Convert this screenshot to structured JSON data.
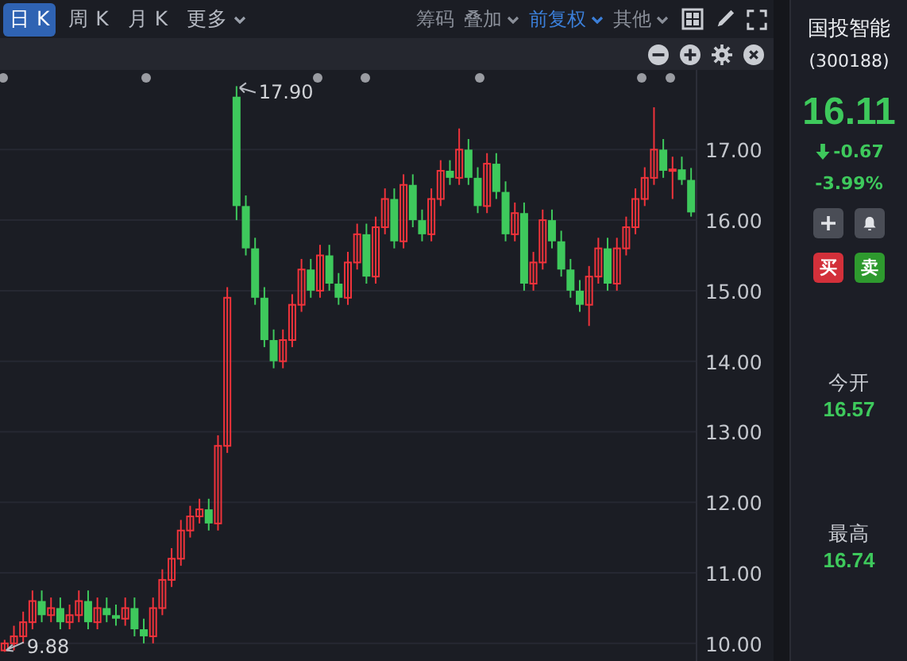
{
  "toolbar": {
    "periods": [
      {
        "label": "日 K",
        "selected": true
      },
      {
        "label": "周 K",
        "selected": false
      },
      {
        "label": "月 K",
        "selected": false
      }
    ],
    "more": {
      "label": "更多"
    },
    "options": [
      {
        "label": "筹码",
        "has_menu": false,
        "selected": false
      },
      {
        "label": "叠加",
        "has_menu": true,
        "selected": false
      },
      {
        "label": "前复权",
        "has_menu": true,
        "selected": true
      },
      {
        "label": "其他",
        "has_menu": true,
        "selected": false
      }
    ]
  },
  "chart": {
    "chart_data": {
      "type": "candlestick",
      "categories": [
        null,
        null,
        null,
        null,
        null,
        null,
        null,
        null,
        null,
        null,
        null,
        null,
        null,
        null,
        null,
        null,
        null,
        null,
        null,
        null,
        null,
        null,
        null,
        null,
        null,
        null,
        null,
        null,
        null,
        null,
        null,
        null,
        null,
        null,
        null,
        null,
        null,
        null,
        null,
        null,
        null,
        null,
        null,
        null,
        null,
        null,
        null,
        null,
        null,
        null,
        null,
        null,
        null,
        null,
        null,
        null,
        null,
        null,
        null,
        null,
        null,
        null,
        null,
        null,
        null,
        null,
        null,
        null,
        null,
        null,
        null,
        null,
        null,
        null,
        null
      ],
      "ohlc": [
        [
          9.9,
          10.05,
          9.88,
          10.0
        ],
        [
          10.0,
          10.25,
          9.9,
          10.1
        ],
        [
          10.1,
          10.45,
          10.0,
          10.3
        ],
        [
          10.3,
          10.75,
          10.2,
          10.6
        ],
        [
          10.6,
          10.75,
          10.3,
          10.4
        ],
        [
          10.4,
          10.65,
          10.3,
          10.5
        ],
        [
          10.5,
          10.65,
          10.2,
          10.3
        ],
        [
          10.3,
          10.55,
          10.2,
          10.4
        ],
        [
          10.4,
          10.75,
          10.3,
          10.6
        ],
        [
          10.6,
          10.75,
          10.2,
          10.3
        ],
        [
          10.3,
          10.65,
          10.2,
          10.5
        ],
        [
          10.5,
          10.65,
          10.3,
          10.4
        ],
        [
          10.4,
          10.55,
          10.25,
          10.35
        ],
        [
          10.35,
          10.65,
          10.25,
          10.5
        ],
        [
          10.5,
          10.65,
          10.1,
          10.2
        ],
        [
          10.2,
          10.35,
          10.0,
          10.1
        ],
        [
          10.1,
          10.65,
          10.0,
          10.5
        ],
        [
          10.5,
          11.05,
          10.4,
          10.9
        ],
        [
          10.9,
          11.35,
          10.8,
          11.2
        ],
        [
          11.2,
          11.75,
          11.1,
          11.6
        ],
        [
          11.6,
          11.95,
          11.5,
          11.8
        ],
        [
          11.8,
          12.05,
          11.7,
          11.9
        ],
        [
          11.9,
          12.05,
          11.6,
          11.7
        ],
        [
          11.7,
          12.95,
          11.6,
          12.8
        ],
        [
          12.8,
          15.05,
          12.7,
          14.9
        ],
        [
          17.75,
          17.9,
          16.0,
          16.2
        ],
        [
          16.2,
          16.35,
          15.5,
          15.6
        ],
        [
          15.6,
          15.75,
          14.8,
          14.9
        ],
        [
          14.9,
          15.05,
          14.2,
          14.3
        ],
        [
          14.3,
          14.45,
          13.9,
          14.0
        ],
        [
          14.0,
          14.45,
          13.9,
          14.3
        ],
        [
          14.3,
          14.95,
          14.2,
          14.8
        ],
        [
          14.8,
          15.45,
          14.7,
          15.3
        ],
        [
          15.3,
          15.45,
          14.9,
          15.0
        ],
        [
          15.0,
          15.65,
          14.9,
          15.5
        ],
        [
          15.5,
          15.65,
          15.0,
          15.1
        ],
        [
          15.1,
          15.25,
          14.8,
          14.9
        ],
        [
          14.9,
          15.55,
          14.8,
          15.4
        ],
        [
          15.4,
          15.95,
          15.3,
          15.8
        ],
        [
          15.8,
          15.95,
          15.1,
          15.2
        ],
        [
          15.2,
          16.05,
          15.1,
          15.9
        ],
        [
          15.9,
          16.45,
          15.8,
          16.3
        ],
        [
          16.3,
          16.45,
          15.6,
          15.7
        ],
        [
          15.7,
          16.65,
          15.6,
          16.5
        ],
        [
          16.5,
          16.65,
          15.9,
          16.0
        ],
        [
          16.0,
          16.15,
          15.7,
          15.8
        ],
        [
          15.8,
          16.45,
          15.7,
          16.3
        ],
        [
          16.3,
          16.85,
          16.2,
          16.7
        ],
        [
          16.7,
          16.85,
          16.5,
          16.6
        ],
        [
          16.6,
          17.3,
          16.5,
          17.0
        ],
        [
          17.0,
          17.15,
          16.5,
          16.6
        ],
        [
          16.6,
          16.75,
          16.1,
          16.2
        ],
        [
          16.2,
          16.95,
          16.1,
          16.8
        ],
        [
          16.8,
          16.95,
          16.3,
          16.4
        ],
        [
          16.4,
          16.55,
          15.7,
          15.8
        ],
        [
          15.8,
          16.25,
          15.7,
          16.1
        ],
        [
          16.1,
          16.25,
          15.0,
          15.1
        ],
        [
          15.1,
          15.55,
          15.0,
          15.4
        ],
        [
          15.4,
          16.15,
          15.3,
          16.0
        ],
        [
          16.0,
          16.15,
          15.6,
          15.7
        ],
        [
          15.7,
          15.85,
          15.2,
          15.3
        ],
        [
          15.3,
          15.45,
          14.9,
          15.0
        ],
        [
          15.0,
          15.15,
          14.7,
          14.8
        ],
        [
          14.8,
          15.35,
          14.5,
          15.2
        ],
        [
          15.2,
          15.75,
          15.1,
          15.6
        ],
        [
          15.6,
          15.75,
          15.0,
          15.1
        ],
        [
          15.1,
          15.75,
          15.0,
          15.6
        ],
        [
          15.6,
          16.05,
          15.5,
          15.9
        ],
        [
          15.9,
          16.45,
          15.8,
          16.3
        ],
        [
          16.3,
          16.75,
          16.2,
          16.6
        ],
        [
          16.6,
          17.6,
          16.5,
          17.0
        ],
        [
          17.0,
          17.15,
          16.6,
          16.7
        ],
        [
          16.7,
          16.9,
          16.3,
          16.72
        ],
        [
          16.72,
          16.9,
          16.5,
          16.57
        ],
        [
          16.57,
          16.74,
          16.05,
          16.11
        ]
      ],
      "grid": true,
      "ylim": [
        9.75,
        18.13
      ],
      "yticks": [
        {
          "value": 17,
          "label": "17.00"
        },
        {
          "value": 16,
          "label": "16.00"
        },
        {
          "value": 15,
          "label": "15.00"
        },
        {
          "value": 14,
          "label": "14.00"
        },
        {
          "value": 13,
          "label": "13.00"
        },
        {
          "value": 12,
          "label": "12.00"
        },
        {
          "value": 11,
          "label": "11.00"
        },
        {
          "value": 10,
          "label": "10.00"
        }
      ],
      "annotations": [
        "17.90",
        "9.88"
      ]
    }
  },
  "quote": {
    "name": "国投智能",
    "code": "(300188)",
    "price": "16.11",
    "change": "-0.67",
    "change_percent": "-3.99%",
    "buy": "买",
    "sell": "卖",
    "stats": [
      {
        "label": "今开",
        "value": "16.57"
      },
      {
        "label": "最高",
        "value": "16.74"
      }
    ]
  }
}
